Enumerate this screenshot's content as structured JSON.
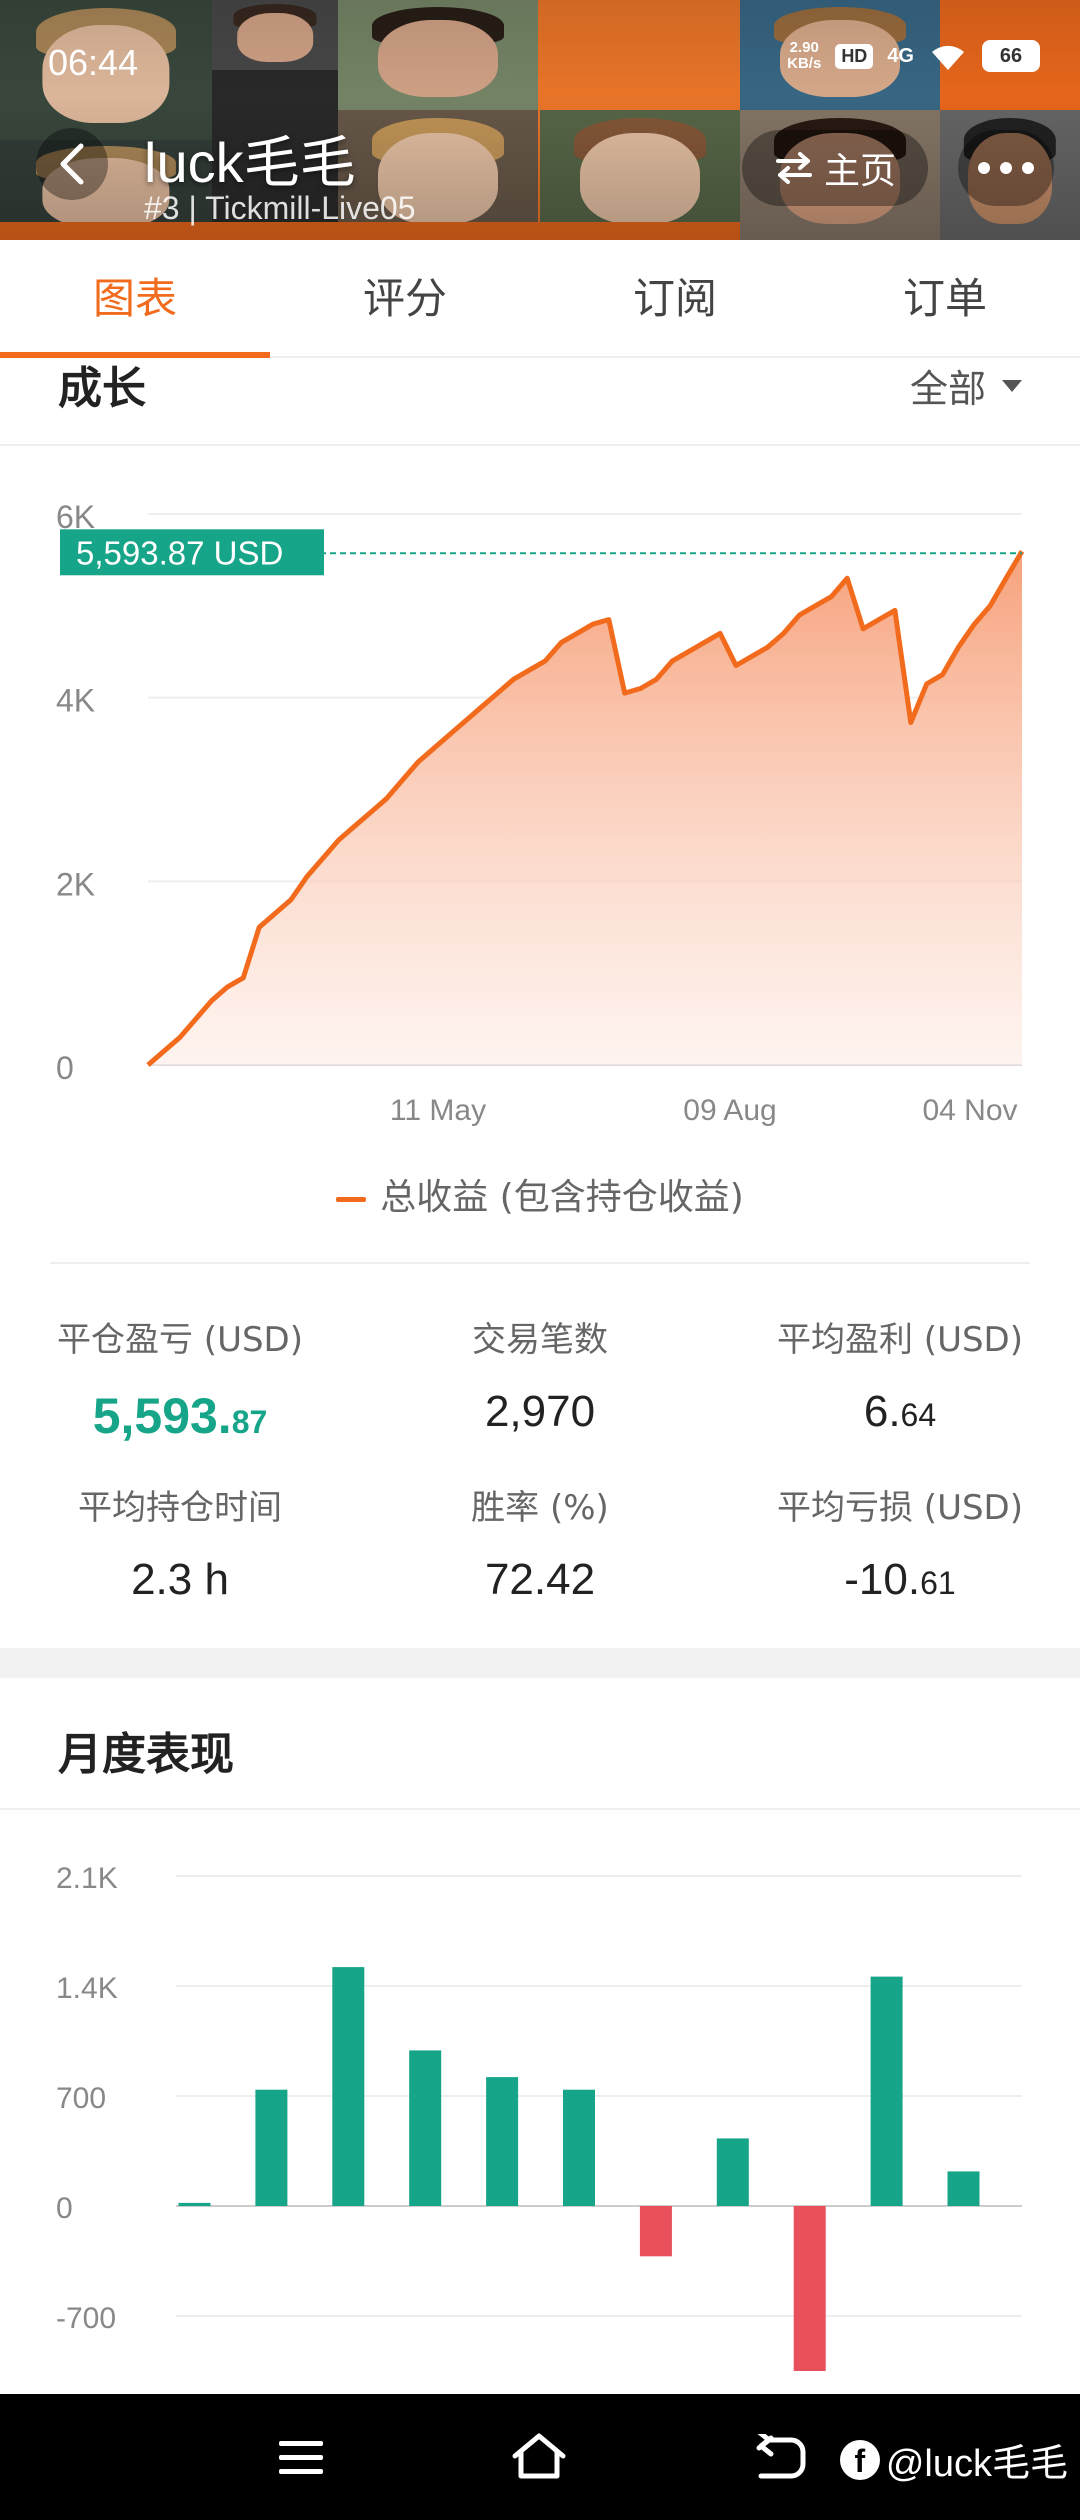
{
  "status_bar": {
    "time": "06:44",
    "net_speed_value": "2.90",
    "net_speed_unit": "KB/s",
    "hd_badge": "HD",
    "signal": "4G",
    "battery": "66"
  },
  "header": {
    "title": "luck毛毛",
    "subtitle": "#3 | Tickmill-Live05",
    "home_label": "主页",
    "accent_color": "#f26b1d"
  },
  "tabs": [
    {
      "label": "图表",
      "active": true
    },
    {
      "label": "评分",
      "active": false
    },
    {
      "label": "订阅",
      "active": false
    },
    {
      "label": "订单",
      "active": false
    }
  ],
  "growth": {
    "section_title": "成长",
    "filter_label": "全部",
    "current_value_label": "5,593.87 USD",
    "legend": "总收益 (包含持仓收益)"
  },
  "chart_data": [
    {
      "type": "area",
      "title": "",
      "y_ticks": [
        "0",
        "2K",
        "4K",
        "6K"
      ],
      "x_ticks": [
        "11 May",
        "09 Aug",
        "04 Nov"
      ],
      "ylim": [
        0,
        6000
      ],
      "series": [
        {
          "name": "总收益 (包含持仓收益)",
          "color": "#f26b1d",
          "values": [
            0,
            150,
            300,
            500,
            700,
            850,
            950,
            1500,
            1650,
            1800,
            2050,
            2250,
            2450,
            2600,
            2750,
            2900,
            3100,
            3300,
            3450,
            3600,
            3750,
            3900,
            4050,
            4200,
            4300,
            4400,
            4600,
            4700,
            4800,
            4850,
            4050,
            4100,
            4200,
            4400,
            4500,
            4600,
            4700,
            4350,
            4450,
            4550,
            4700,
            4900,
            5000,
            5100,
            5300,
            4750,
            4850,
            4950,
            3730,
            4150,
            4250,
            4550,
            4800,
            5000,
            5300,
            5593.87
          ]
        }
      ]
    },
    {
      "type": "bar",
      "title": "",
      "y_ticks": [
        "-700",
        "0",
        "700",
        "1.4K",
        "2.1K"
      ],
      "ylim": [
        -1050,
        2100
      ],
      "values": [
        20,
        740,
        1520,
        990,
        820,
        740,
        -320,
        430,
        -1050,
        1460,
        220
      ],
      "positive_color": "#17a589",
      "negative_color": "#e8505b"
    }
  ],
  "stats": [
    {
      "label": "平仓盈亏 (USD)",
      "int": "5,593.",
      "dec": "87",
      "highlight": true
    },
    {
      "label": "交易笔数",
      "int": "2,970",
      "dec": "",
      "highlight": false
    },
    {
      "label": "平均盈利 (USD)",
      "int": "6.",
      "dec": "64",
      "highlight": false
    },
    {
      "label": "平均持仓时间",
      "int": "2.3 h",
      "dec": "",
      "highlight": false
    },
    {
      "label": "胜率 (%)",
      "int": "72.42",
      "dec": "",
      "highlight": false
    },
    {
      "label": "平均亏损 (USD)",
      "int": "-10.",
      "dec": "61",
      "highlight": false
    }
  ],
  "monthly": {
    "section_title": "月度表现"
  },
  "navbar": {
    "watermark": "@luck毛毛",
    "fb_letter": "f",
    "icons": [
      "menu-icon",
      "home-icon",
      "back-icon"
    ]
  }
}
